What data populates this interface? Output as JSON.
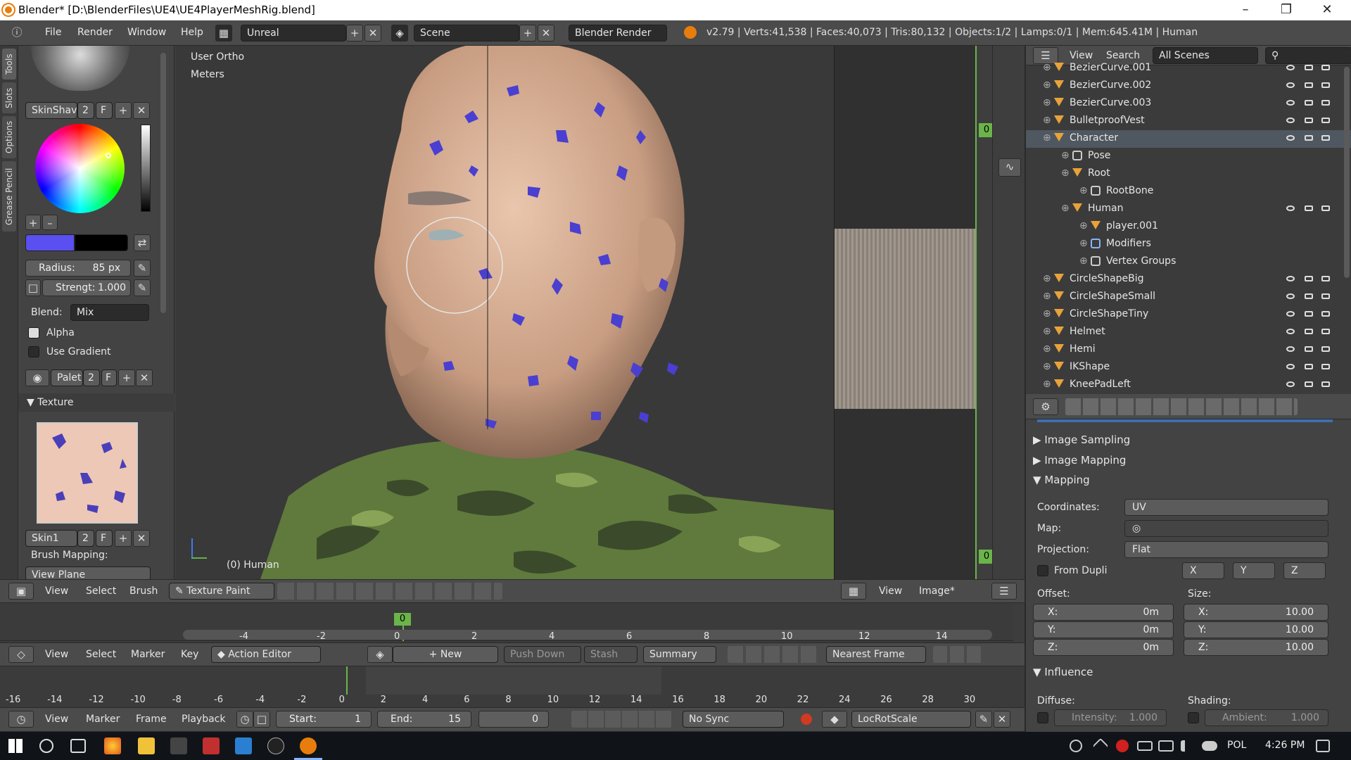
{
  "window": {
    "title": "Blender* [D:\\BlenderFiles\\UE4\\UE4PlayerMeshRig.blend]"
  },
  "menu": {
    "items": [
      "File",
      "Render",
      "Window",
      "Help"
    ],
    "layout": "Unreal",
    "scene": "Scene",
    "engine": "Blender Render",
    "stats": "v2.79 | Verts:41,538 | Faces:40,073 | Tris:80,132 | Objects:1/2 | Lamps:0/1 | Mem:645.41M | Human"
  },
  "tools": {
    "tabs": [
      "Tools",
      "Slots",
      "Options",
      "Grease Pencil"
    ],
    "brush_name": "SkinShav",
    "brush_users": "2",
    "fake_user": "F",
    "radius_label": "Radius:",
    "radius_value": "85 px",
    "strength_label": "Strengt:",
    "strength_value": "1.000",
    "blend_label": "Blend:",
    "blend_value": "Mix",
    "alpha_label": "Alpha",
    "gradient_label": "Use Gradient",
    "palette_name": "Palet",
    "palette_users": "2",
    "texture_section": "Texture",
    "texture_name": "Skin1",
    "texture_users": "2",
    "mapping_label": "Brush Mapping:",
    "mapping_value": "View Plane",
    "primary_color": "#5a4ff0",
    "secondary_color": "#000000"
  },
  "viewport": {
    "view_label": "User Ortho",
    "units_label": "Meters",
    "object_label": "(0) Human",
    "header": [
      "View",
      "Select",
      "Brush"
    ],
    "mode": "Texture Paint"
  },
  "image_editor": {
    "header": [
      "View",
      "Image*"
    ]
  },
  "outliner": {
    "header": [
      "View",
      "Search"
    ],
    "filter": "All Scenes",
    "rows": [
      {
        "name": "BezierCurve.001",
        "indent": 0,
        "icon": "curve"
      },
      {
        "name": "BezierCurve.002",
        "indent": 0,
        "icon": "curve"
      },
      {
        "name": "BezierCurve.003",
        "indent": 0,
        "icon": "curve"
      },
      {
        "name": "BulletproofVest",
        "indent": 0,
        "icon": "mesh"
      },
      {
        "name": "Character",
        "indent": 0,
        "icon": "armature",
        "selected": true
      },
      {
        "name": "Pose",
        "indent": 1,
        "icon": "pose"
      },
      {
        "name": "Root",
        "indent": 1,
        "icon": "armature"
      },
      {
        "name": "RootBone",
        "indent": 2,
        "icon": "bone"
      },
      {
        "name": "Human",
        "indent": 1,
        "icon": "mesh"
      },
      {
        "name": "player.001",
        "indent": 2,
        "icon": "mesh"
      },
      {
        "name": "Modifiers",
        "indent": 2,
        "icon": "wrench"
      },
      {
        "name": "Vertex Groups",
        "indent": 2,
        "icon": "vgroup"
      },
      {
        "name": "CircleShapeBig",
        "indent": 0,
        "icon": "mesh"
      },
      {
        "name": "CircleShapeSmall",
        "indent": 0,
        "icon": "mesh"
      },
      {
        "name": "CircleShapeTiny",
        "indent": 0,
        "icon": "mesh"
      },
      {
        "name": "Helmet",
        "indent": 0,
        "icon": "mesh"
      },
      {
        "name": "Hemi",
        "indent": 0,
        "icon": "lamp"
      },
      {
        "name": "IKShape",
        "indent": 0,
        "icon": "mesh"
      },
      {
        "name": "KneePadLeft",
        "indent": 0,
        "icon": "mesh"
      }
    ]
  },
  "properties": {
    "image_sampling": "Image Sampling",
    "image_mapping": "Image Mapping",
    "mapping": "Mapping",
    "coordinates_label": "Coordinates:",
    "coordinates_value": "UV",
    "map_label": "Map:",
    "projection_label": "Projection:",
    "projection_value": "Flat",
    "from_dupli": "From Dupli",
    "axis_x": "X",
    "axis_y": "Y",
    "axis_z": "Z",
    "offset_label": "Offset:",
    "size_label": "Size:",
    "offset": [
      {
        "axis": "X:",
        "value": "0m"
      },
      {
        "axis": "Y:",
        "value": "0m"
      },
      {
        "axis": "Z:",
        "value": "0m"
      }
    ],
    "size": [
      {
        "axis": "X:",
        "value": "10.00"
      },
      {
        "axis": "Y:",
        "value": "10.00"
      },
      {
        "axis": "Z:",
        "value": "10.00"
      }
    ],
    "influence": "Influence",
    "diffuse_label": "Diffuse:",
    "shading_label": "Shading:",
    "intensity_label": "Intensity:",
    "intensity_value": "1.000",
    "ambient_label": "Ambient:",
    "ambient_value": "1.000"
  },
  "timeline_top": {
    "ticks": [
      "-4",
      "-2",
      "0",
      "2",
      "4",
      "6",
      "8",
      "10",
      "12",
      "14"
    ],
    "current": "0"
  },
  "action_editor": {
    "header": [
      "View",
      "Select",
      "Marker",
      "Key"
    ],
    "mode": "Action Editor",
    "new": "New",
    "push_down": "Push Down",
    "stash": "Stash",
    "summary": "Summary",
    "snap": "Nearest Frame"
  },
  "timeline_ruler": {
    "ticks": [
      "-16",
      "-14",
      "-12",
      "-10",
      "-8",
      "-6",
      "-4",
      "-2",
      "0",
      "2",
      "4",
      "6",
      "8",
      "10",
      "12",
      "14",
      "16",
      "18",
      "20",
      "22",
      "24",
      "26",
      "28",
      "30"
    ]
  },
  "timeline": {
    "header": [
      "View",
      "Marker",
      "Frame",
      "Playback"
    ],
    "start_label": "Start:",
    "start": "1",
    "end_label": "End:",
    "end": "15",
    "current": "0",
    "sync": "No Sync",
    "keying": "LocRotScale"
  },
  "taskbar": {
    "lang": "POL",
    "time": "4:26 PM"
  }
}
